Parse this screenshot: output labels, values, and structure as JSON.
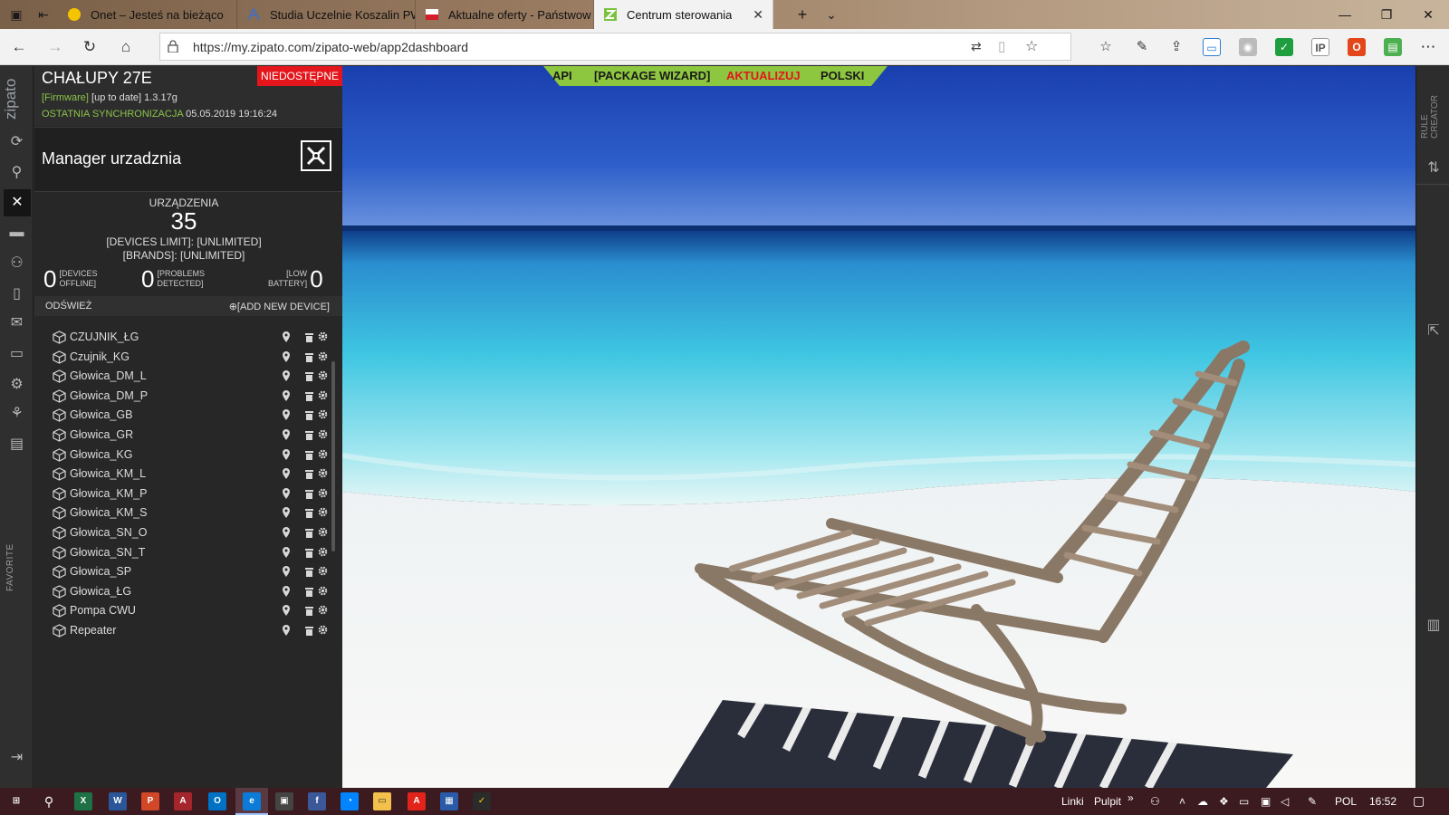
{
  "browser": {
    "tabs": [
      {
        "title": "Onet – Jesteś na bieżąco",
        "fav": "#f5c400"
      },
      {
        "title": "Studia Uczelnie Koszalin PW",
        "fav": "#4a6fb5"
      },
      {
        "title": "Aktualne oferty - Państwow",
        "fav": "#d21f2a"
      },
      {
        "title": "Centrum sterowania",
        "fav": "#7cc242"
      }
    ],
    "url": "https://my.zipato.com/zipato-web/app2dashboard"
  },
  "rail": {
    "brand": "zipato",
    "favorite": "FAVORITE"
  },
  "controller": {
    "name": "CHAŁUPY 27E",
    "status_badge": "NIEDOSTĘPNE",
    "firmware_label": "[Firmware]",
    "firmware_state": "[up to date]",
    "firmware_version": "1.3.17g",
    "sync_label": "OSTATNIA SYNCHRONIZACJA",
    "sync_time": "05.05.2019 19:16:24"
  },
  "manager": {
    "title": "Manager urzadznia"
  },
  "stats": {
    "devices_label": "URZĄDZENIA",
    "devices_count": "35",
    "devices_limit": "[DEVICES LIMIT]: [UNLIMITED]",
    "brands_limit": "[BRANDS]: [UNLIMITED]",
    "offline_count": "0",
    "offline_l1": "[DEVICES",
    "offline_l2": "OFFLINE]",
    "problems_count": "0",
    "problems_l1": "[PROBLEMS",
    "problems_l2": "DETECTED]",
    "battery_l1": "[LOW",
    "battery_l2": "BATTERY]",
    "battery_count": "0"
  },
  "actions": {
    "refresh": "ODŚWIEŻ",
    "add_device": "[ADD NEW DEVICE]"
  },
  "devices": [
    "CZUJNIK_ŁG",
    "Czujnik_KG",
    "Głowica_DM_L",
    "Głowica_DM_P",
    "Głowica_GB",
    "Głowica_GR",
    "Głowica_KG",
    "Głowica_KM_L",
    "Głowica_KM_P",
    "Głowica_KM_S",
    "Głowica_SN_O",
    "Głowica_SN_T",
    "Głowica_SP",
    "Głowica_ŁG",
    "Pompa CWU",
    "Repeater"
  ],
  "topmenu": {
    "api": "API",
    "wizard": "[PACKAGE WIZARD]",
    "update": "AKTUALIZUJ",
    "lang": "POLSKI"
  },
  "right_rail": {
    "rule_creator": "RULE CREATOR"
  },
  "taskbar": {
    "links": "Linki",
    "desktop": "Pulpit",
    "lang": "POL",
    "time": "16:52"
  },
  "colors": {
    "accent_green": "#8bc34a",
    "alert_red": "#e4161b",
    "menu_green": "#8dc63f"
  }
}
